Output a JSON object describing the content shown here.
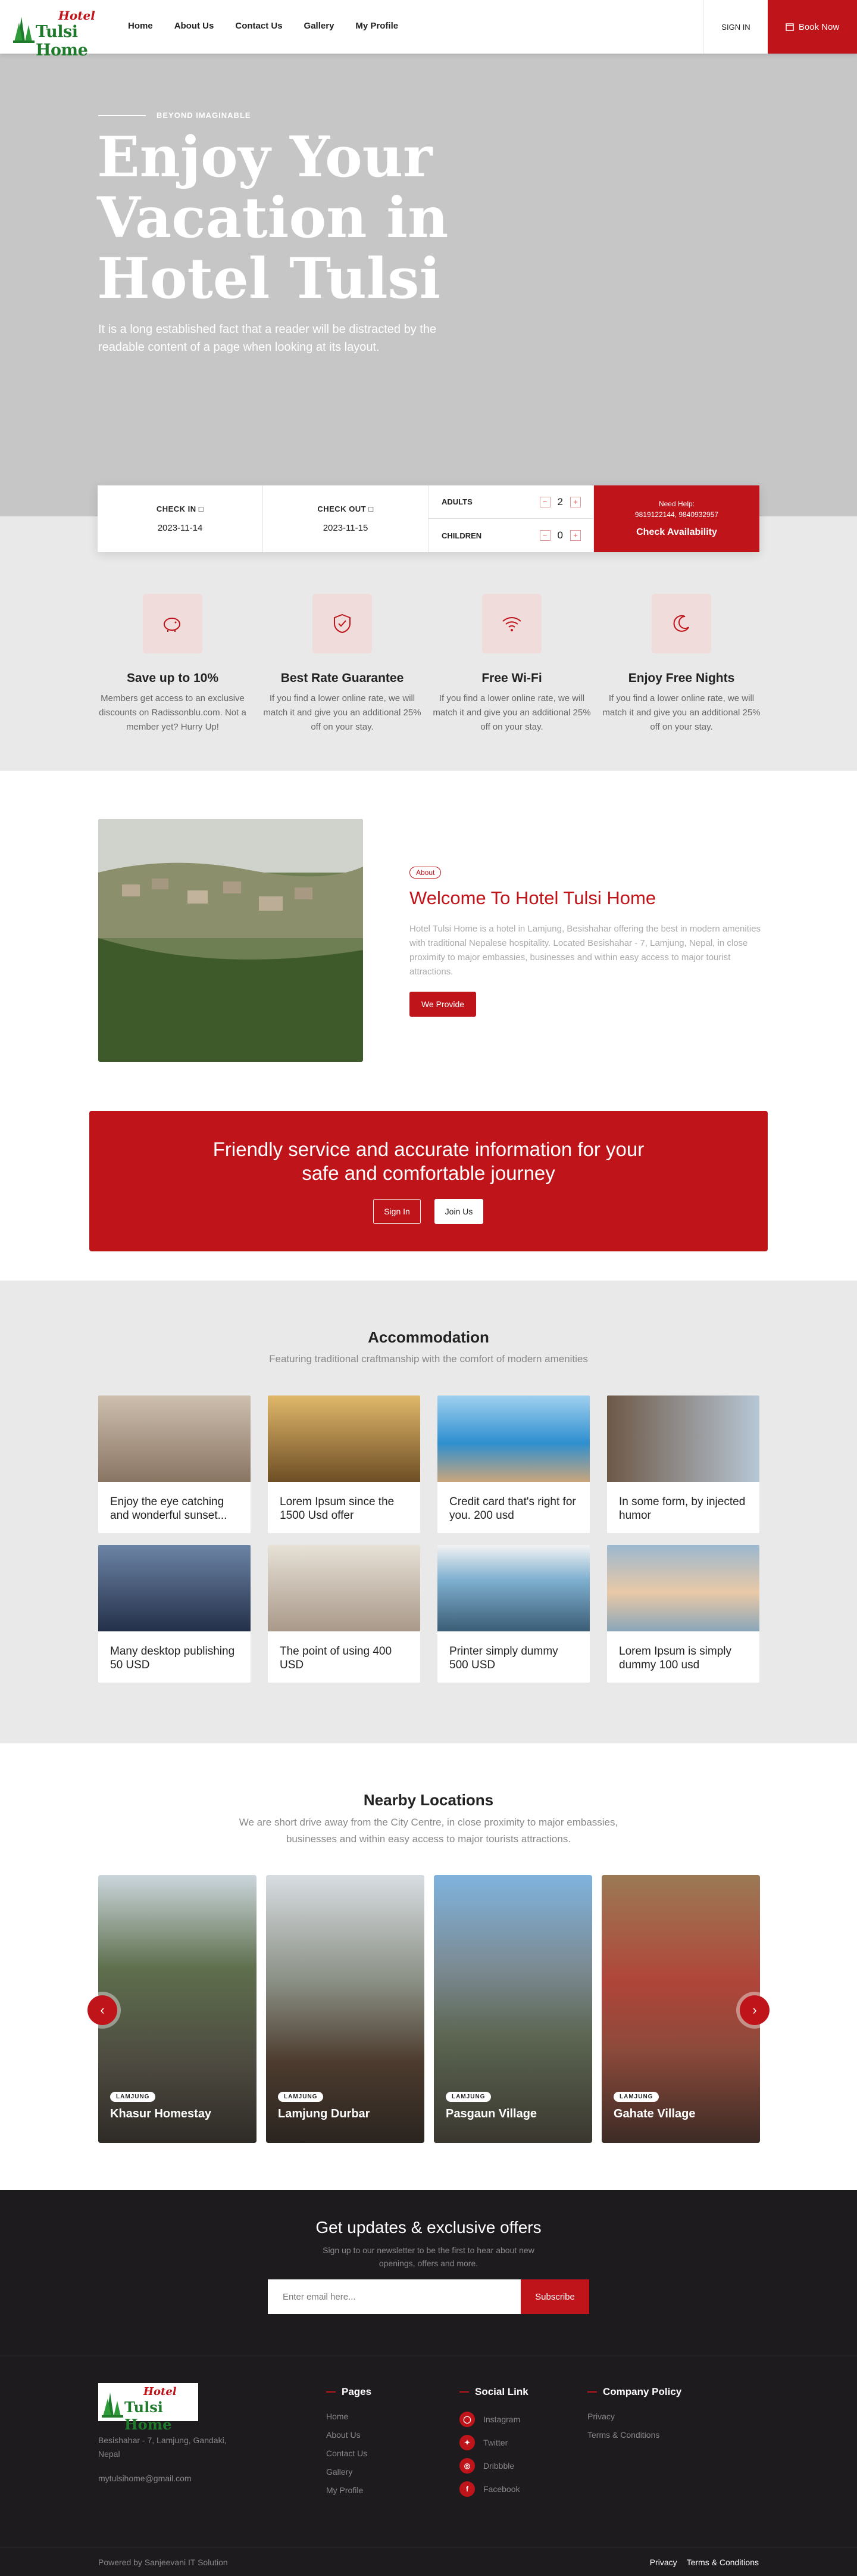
{
  "header": {
    "logo_hotel": "Hotel",
    "logo_name": "Tulsi Home",
    "nav": [
      "Home",
      "About Us",
      "Contact Us",
      "Gallery",
      "My Profile"
    ],
    "signin": "SIGN IN",
    "booknow": "Book Now"
  },
  "hero": {
    "tag": "BEYOND IMAGINABLE",
    "title": "Enjoy Your Vacation in Hotel Tulsi",
    "subtitle": "It is a long established fact that a reader will be distracted by the readable content of a page when looking at its layout."
  },
  "booking": {
    "checkin_label": "CHECK IN",
    "checkin_value": "2023-11-14",
    "checkout_label": "CHECK OUT",
    "checkout_value": "2023-11-15",
    "adults_label": "ADULTS",
    "adults_value": "2",
    "children_label": "CHILDREN",
    "children_value": "0",
    "help_label": "Need Help:",
    "help_phone": "9819122144, 9840932957",
    "availability": "Check Availability"
  },
  "features": [
    {
      "title": "Save up to 10%",
      "desc": "Members get access to an exclusive discounts on Radissonblu.com. Not a member yet? Hurry Up!"
    },
    {
      "title": "Best Rate Guarantee",
      "desc": "If you find a lower online rate, we will match it and give you an additional 25% off on your stay."
    },
    {
      "title": "Free Wi-Fi",
      "desc": "If you find a lower online rate, we will match it and give you an additional 25% off on your stay."
    },
    {
      "title": "Enjoy Free Nights",
      "desc": "If you find a lower online rate, we will match it and give you an additional 25% off on your stay."
    }
  ],
  "about": {
    "badge": "About",
    "title": "Welcome To Hotel Tulsi Home",
    "text": "Hotel Tulsi Home is a hotel in Lamjung, Besishahar offering the best in modern amenities with traditional Nepalese hospitality. Located Besishahar - 7, Lamjung, Nepal, in close proximity to major embassies, businesses and within easy access to major tourist attractions.",
    "button": "We Provide"
  },
  "cta": {
    "title": "Friendly service and accurate information for your safe and comfortable journey",
    "signin": "Sign In",
    "joinus": "Join Us"
  },
  "accommodation": {
    "title": "Accommodation",
    "subtitle": "Featuring traditional craftmanship with the comfort of modern amenities",
    "items": [
      "Enjoy the eye catching and wonderful sunset...",
      "Lorem Ipsum since the 1500 Usd offer",
      "Credit card that's right for you. 200 usd",
      "In some form, by injected humor",
      "Many desktop publishing 50 USD",
      "The point of using 400 USD",
      "Printer simply dummy 500 USD",
      "Lorem Ipsum is simply dummy 100 usd"
    ],
    "colors": [
      "#a89482",
      "#b8873f",
      "#3d97c8",
      "#8a7f6f",
      "#46566e",
      "#cfc4b5",
      "#5d8fb0",
      "#d9b08d"
    ]
  },
  "nearby": {
    "title": "Nearby Locations",
    "subtitle": "We are short drive away from the City Centre, in close proximity to major embassies, businesses and within easy access to major tourists attractions.",
    "items": [
      {
        "tag": "LAMJUNG",
        "name": "Khasur Homestay"
      },
      {
        "tag": "LAMJUNG",
        "name": "Lamjung Durbar"
      },
      {
        "tag": "LAMJUNG",
        "name": "Pasgaun Village"
      },
      {
        "tag": "LAMJUNG",
        "name": "Gahate Village"
      }
    ]
  },
  "newsletter": {
    "title": "Get updates & exclusive offers",
    "subtitle": "Sign up to our newsletter to be the first to hear about new openings, offers and more.",
    "placeholder": "Enter email here...",
    "button": "Subscribe"
  },
  "footer": {
    "address": "Besishahar - 7, Lamjung, Gandaki, Nepal",
    "email": "mytulsihome@gmail.com",
    "pages_title": "Pages",
    "pages": [
      "Home",
      "About Us",
      "Contact Us",
      "Gallery",
      "My Profile"
    ],
    "social_title": "Social Link",
    "social": [
      "Instagram",
      "Twitter",
      "Dribbble",
      "Facebook"
    ],
    "company_title": "Company Policy",
    "company": [
      "Privacy",
      "Terms & Conditions"
    ],
    "copyright": "Powered by Sanjeevani IT Solution",
    "bottom_links": [
      "Privacy",
      "Terms & Conditions"
    ]
  }
}
